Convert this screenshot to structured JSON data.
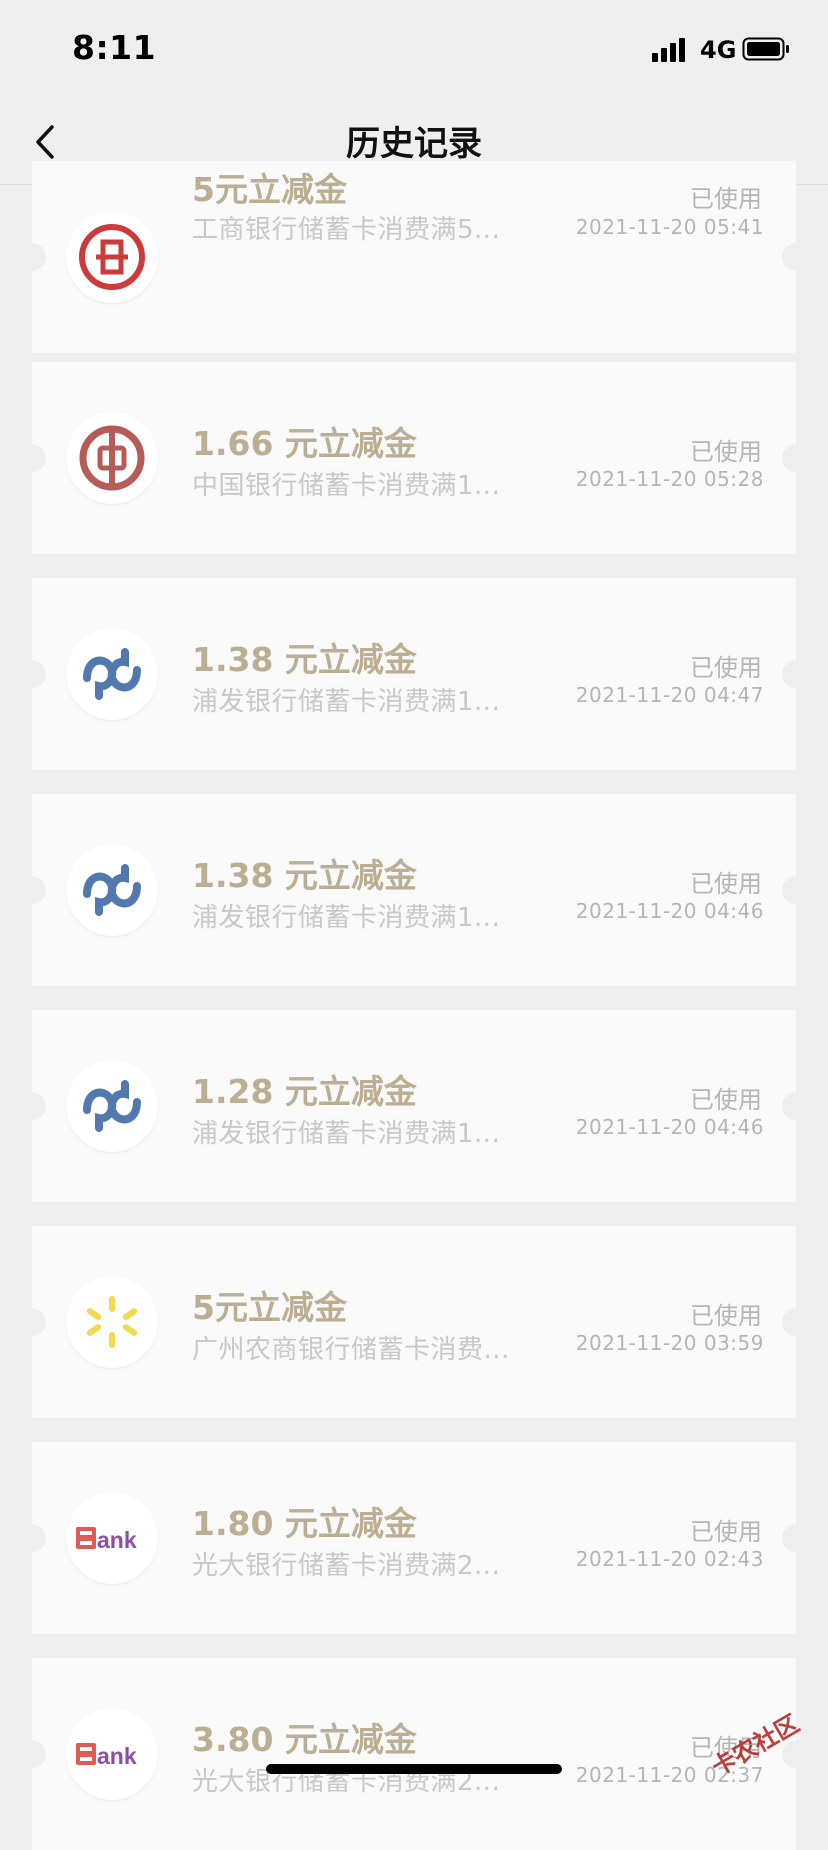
{
  "status_bar": {
    "time": "8:11",
    "network": "4G"
  },
  "header": {
    "title": "历史记录",
    "back_icon": "chevron-left-icon"
  },
  "records": [
    {
      "logo": "icbc-logo",
      "amount": "5元立减金",
      "description": "工商银行储蓄卡消费满5...",
      "status": "已使用",
      "datetime": "2021-11-20 05:41"
    },
    {
      "logo": "boc-logo",
      "amount": "1.66 元立减金",
      "description": "中国银行储蓄卡消费满1...",
      "status": "已使用",
      "datetime": "2021-11-20 05:28"
    },
    {
      "logo": "spdb-logo",
      "amount": "1.38 元立减金",
      "description": "浦发银行储蓄卡消费满1...",
      "status": "已使用",
      "datetime": "2021-11-20 04:47"
    },
    {
      "logo": "spdb-logo",
      "amount": "1.38 元立减金",
      "description": "浦发银行储蓄卡消费满1...",
      "status": "已使用",
      "datetime": "2021-11-20 04:46"
    },
    {
      "logo": "spdb-logo",
      "amount": "1.28 元立减金",
      "description": "浦发银行储蓄卡消费满1...",
      "status": "已使用",
      "datetime": "2021-11-20 04:46"
    },
    {
      "logo": "grcb-logo",
      "amount": "5元立减金",
      "description": "广州农商银行储蓄卡消费...",
      "status": "已使用",
      "datetime": "2021-11-20 03:59"
    },
    {
      "logo": "ceb-logo",
      "amount": "1.80 元立减金",
      "description": "光大银行储蓄卡消费满2...",
      "status": "已使用",
      "datetime": "2021-11-20 02:43"
    },
    {
      "logo": "ceb-logo",
      "amount": "3.80 元立减金",
      "description": "光大银行储蓄卡消费满2...",
      "status": "已使用",
      "datetime": "2021-11-20 02:37"
    }
  ],
  "watermark": "卡农社区",
  "colors": {
    "amount": "#bcae93",
    "secondary_text": "#c8c8c8",
    "status_text": "#b5b5b5",
    "background": "#efefef",
    "card": "#fafafa"
  }
}
